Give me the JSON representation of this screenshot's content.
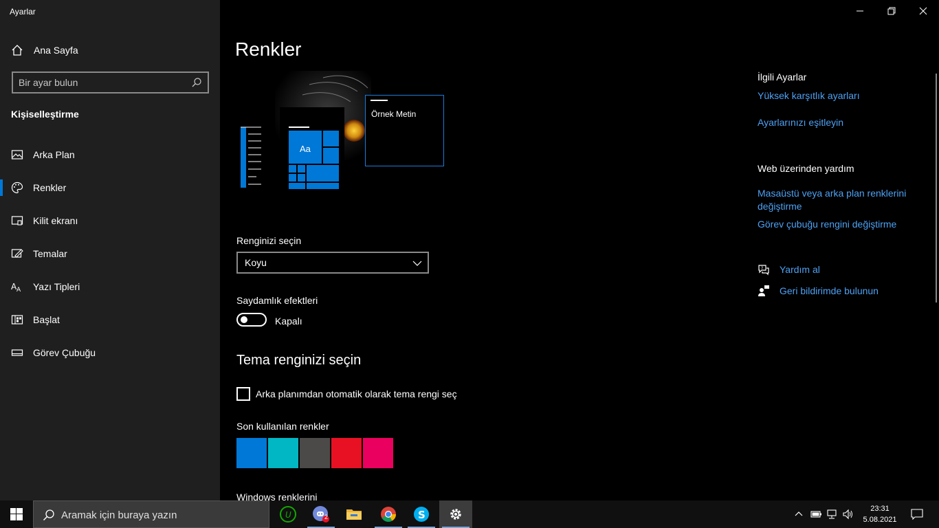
{
  "window": {
    "title": "Ayarlar"
  },
  "sidebar": {
    "home_label": "Ana Sayfa",
    "search_placeholder": "Bir ayar bulun",
    "section_title": "Kişiselleştirme",
    "items": [
      {
        "label": "Arka Plan",
        "icon": "image-icon"
      },
      {
        "label": "Renkler",
        "icon": "palette-icon",
        "active": true
      },
      {
        "label": "Kilit ekranı",
        "icon": "lock-screen-icon"
      },
      {
        "label": "Temalar",
        "icon": "theme-icon"
      },
      {
        "label": "Yazı Tipleri",
        "icon": "font-icon"
      },
      {
        "label": "Başlat",
        "icon": "start-icon"
      },
      {
        "label": "Görev Çubuğu",
        "icon": "taskbar-icon"
      }
    ]
  },
  "main": {
    "title": "Renkler",
    "preview_sample_text": "Örnek Metin",
    "preview_tile_text": "Aa",
    "color_choice_label": "Renginizi seçin",
    "color_choice_value": "Koyu",
    "transparency_label": "Saydamlık efektleri",
    "transparency_state": "Kapalı",
    "accent_title": "Tema renginizi seçin",
    "auto_accent_label": "Arka planımdan otomatik olarak tema rengi seç",
    "recent_colors_label": "Son kullanılan renkler",
    "recent_colors": [
      "#0078d7",
      "#00b7c3",
      "#4c4a48",
      "#e81123",
      "#ea005e"
    ],
    "windows_colors_label": "Windows renklerini"
  },
  "related": {
    "heading": "İlgili Ayarlar",
    "links": [
      "Yüksek karşıtlık ayarları",
      "Ayarlarınızı eşitleyin"
    ],
    "web_heading": "Web üzerinden yardım",
    "web_links": [
      "Masaüstü veya arka plan renklerini değiştirme",
      "Görev çubuğu rengini değiştirme"
    ],
    "help_label": "Yardım al",
    "feedback_label": "Geri bildirimde bulunun"
  },
  "taskbar": {
    "search_placeholder": "Aramak için buraya yazın",
    "badge_count": "2",
    "time": "23:31",
    "date": "5.08.2021"
  },
  "colors": {
    "accent": "#0078d7",
    "link": "#4ea1f3"
  }
}
